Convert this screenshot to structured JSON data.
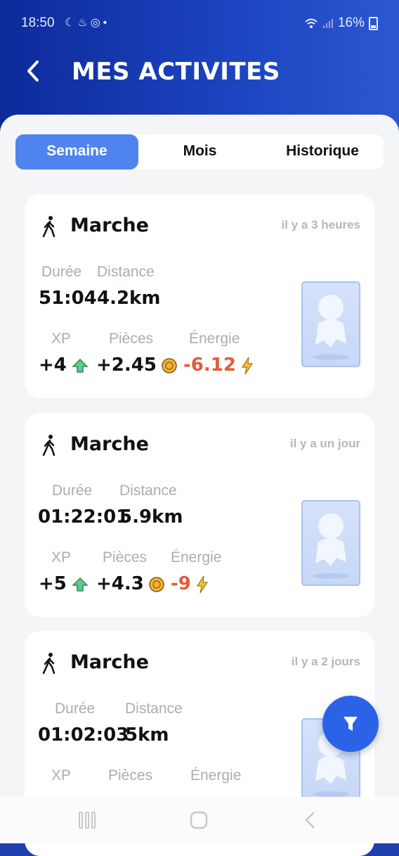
{
  "status_bar": {
    "time": "18:50",
    "icons_left": [
      "moon-icon",
      "drop-icon",
      "messenger-icon",
      "dot-icon"
    ],
    "battery": "16%",
    "icons_right": [
      "wifi-icon",
      "signal-icon",
      "battery-icon"
    ]
  },
  "header": {
    "title": "MES ACTIVITES",
    "back_icon": "chevron-left-icon"
  },
  "tabs": [
    {
      "label": "Semaine",
      "active": true
    },
    {
      "label": "Mois",
      "active": false
    },
    {
      "label": "Historique",
      "active": false
    }
  ],
  "activities": [
    {
      "type": "Marche",
      "ago": "il y a 3 heures",
      "duration_label": "Durée",
      "duration": "51:04",
      "distance_label": "Distance",
      "distance": "4.2km",
      "xp_label": "XP",
      "xp": "+4",
      "coins_label": "Pièces",
      "coins": "+2.45",
      "energy_label": "Énergie",
      "energy": "-6.12"
    },
    {
      "type": "Marche",
      "ago": "il y a un jour",
      "duration_label": "Durée",
      "duration": "01:22:01",
      "distance_label": "Distance",
      "distance": "5.9km",
      "xp_label": "XP",
      "xp": "+5",
      "coins_label": "Pièces",
      "coins": "+4.3",
      "energy_label": "Énergie",
      "energy": "-9"
    },
    {
      "type": "Marche",
      "ago": "il y a 2 jours",
      "duration_label": "Durée",
      "duration": "01:02:03",
      "distance_label": "Distance",
      "distance": "5km",
      "xp_label": "XP",
      "coins_label": "Pièces",
      "energy_label": "Énergie"
    }
  ],
  "colors": {
    "accent": "#4f84ee",
    "negative": "#e25b3b",
    "header": "#1d45c2",
    "fab": "#2a63e6"
  },
  "fab_icon": "filter-icon",
  "nav_icons": [
    "recent-apps-icon",
    "home-icon",
    "back-icon"
  ]
}
